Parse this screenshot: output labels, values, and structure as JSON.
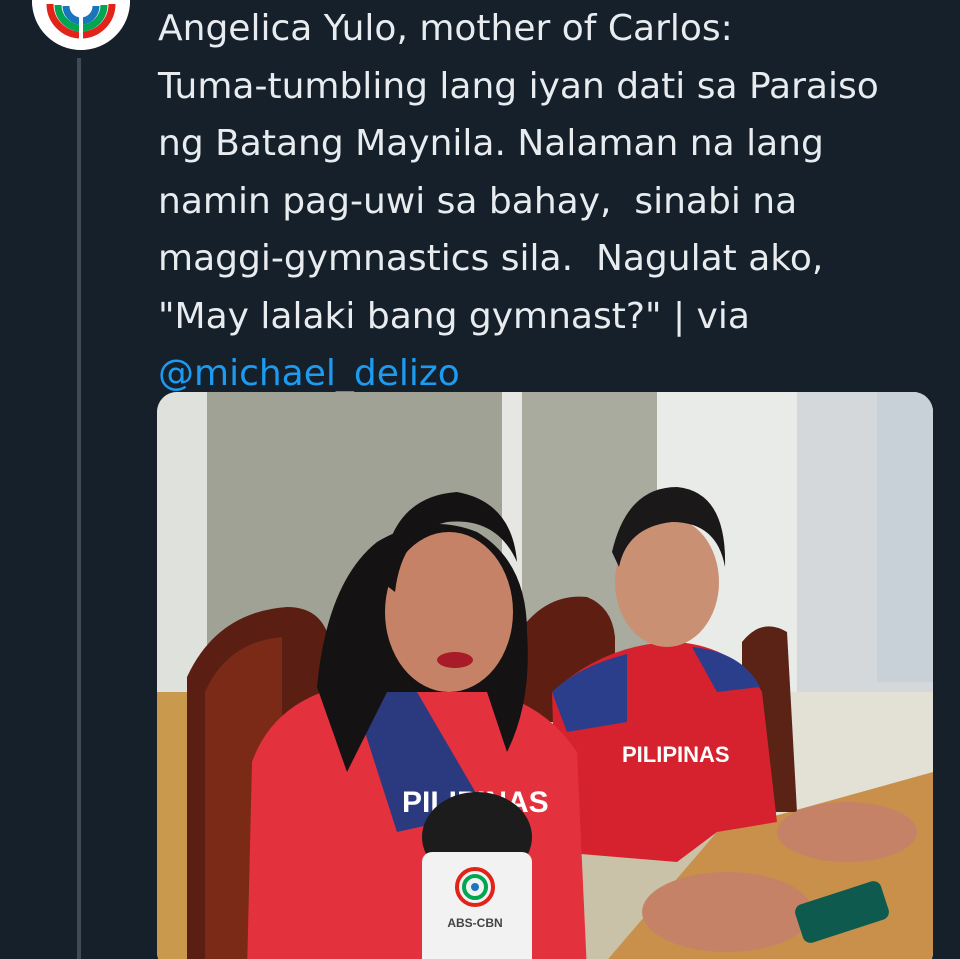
{
  "tweet": {
    "lines": [
      "Angelica Yulo, mother of Carlos:",
      "Tuma-tumbling lang iyan dati sa Paraiso",
      "ng Batang Maynila. Nalaman na lang",
      "namin pag-uwi sa bahay,  sinabi na",
      "maggi-gymnastics sila.  Nagulat ako,",
      "\"May lalaki bang gymnast?\" | via"
    ],
    "mention": "@michael_delizo"
  },
  "author": {
    "avatar_icon": "abs-cbn-logo-icon"
  },
  "media": {
    "microphone_logo_text": "ABS-CBN",
    "shirt_text_left": "PILIPINAS",
    "shirt_text_right": "PILIPINAS"
  },
  "colors": {
    "background": "#15202b",
    "text": "#e8ecef",
    "link": "#1d9bf0",
    "thread_line": "#3d4a57"
  }
}
